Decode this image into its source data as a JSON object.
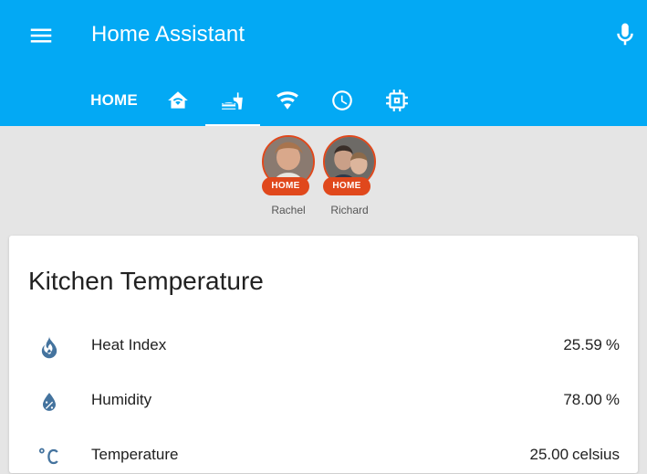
{
  "app": {
    "title": "Home Assistant"
  },
  "tabs": [
    {
      "label": "HOME",
      "active": false
    },
    {
      "icon": "home-wifi-icon",
      "active": false
    },
    {
      "icon": "food-drink-icon",
      "active": true
    },
    {
      "icon": "wifi-icon",
      "active": false
    },
    {
      "icon": "clock-icon",
      "active": false
    },
    {
      "icon": "chip-icon",
      "active": false
    }
  ],
  "badges": [
    {
      "state": "HOME",
      "name": "Rachel"
    },
    {
      "state": "HOME",
      "name": "Richard"
    }
  ],
  "card": {
    "title": "Kitchen Temperature",
    "rows": [
      {
        "icon": "fire-icon",
        "name": "Heat Index",
        "value": "25.59",
        "unit": "%"
      },
      {
        "icon": "water-percent-icon",
        "name": "Humidity",
        "value": "78.00",
        "unit": "%"
      },
      {
        "icon": "temperature-celsius-icon",
        "name": "Temperature",
        "value": "25.00",
        "unit": "celsius"
      }
    ]
  },
  "colors": {
    "toolbar": "#03a9f4",
    "badge": "#e0481c",
    "icon": "#44739e",
    "background": "#e5e5e5"
  }
}
